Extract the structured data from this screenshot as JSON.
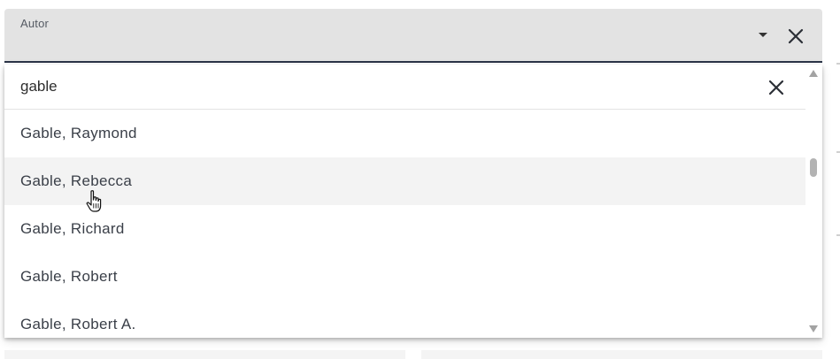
{
  "field": {
    "label": "Autor",
    "arrow_icon": "caret-down-icon",
    "clear_icon": "close-icon"
  },
  "search": {
    "value": "gable",
    "placeholder": "",
    "clear_icon": "close-icon"
  },
  "options": [
    {
      "label": "Gable, Raymond"
    },
    {
      "label": "Gable, Rebecca",
      "hovered": true
    },
    {
      "label": "Gable, Richard"
    },
    {
      "label": "Gable, Robert"
    },
    {
      "label": "Gable, Robert A."
    }
  ],
  "scrollbar": {
    "up_icon": "triangle-up-icon",
    "down_icon": "triangle-down-icon"
  },
  "cursor": {
    "icon": "hand-pointer-icon"
  },
  "colors": {
    "field_background": "#e3e3e3",
    "field_underline": "#2b3447",
    "hover_background": "#f3f3f3",
    "text": "#3a3f48"
  }
}
